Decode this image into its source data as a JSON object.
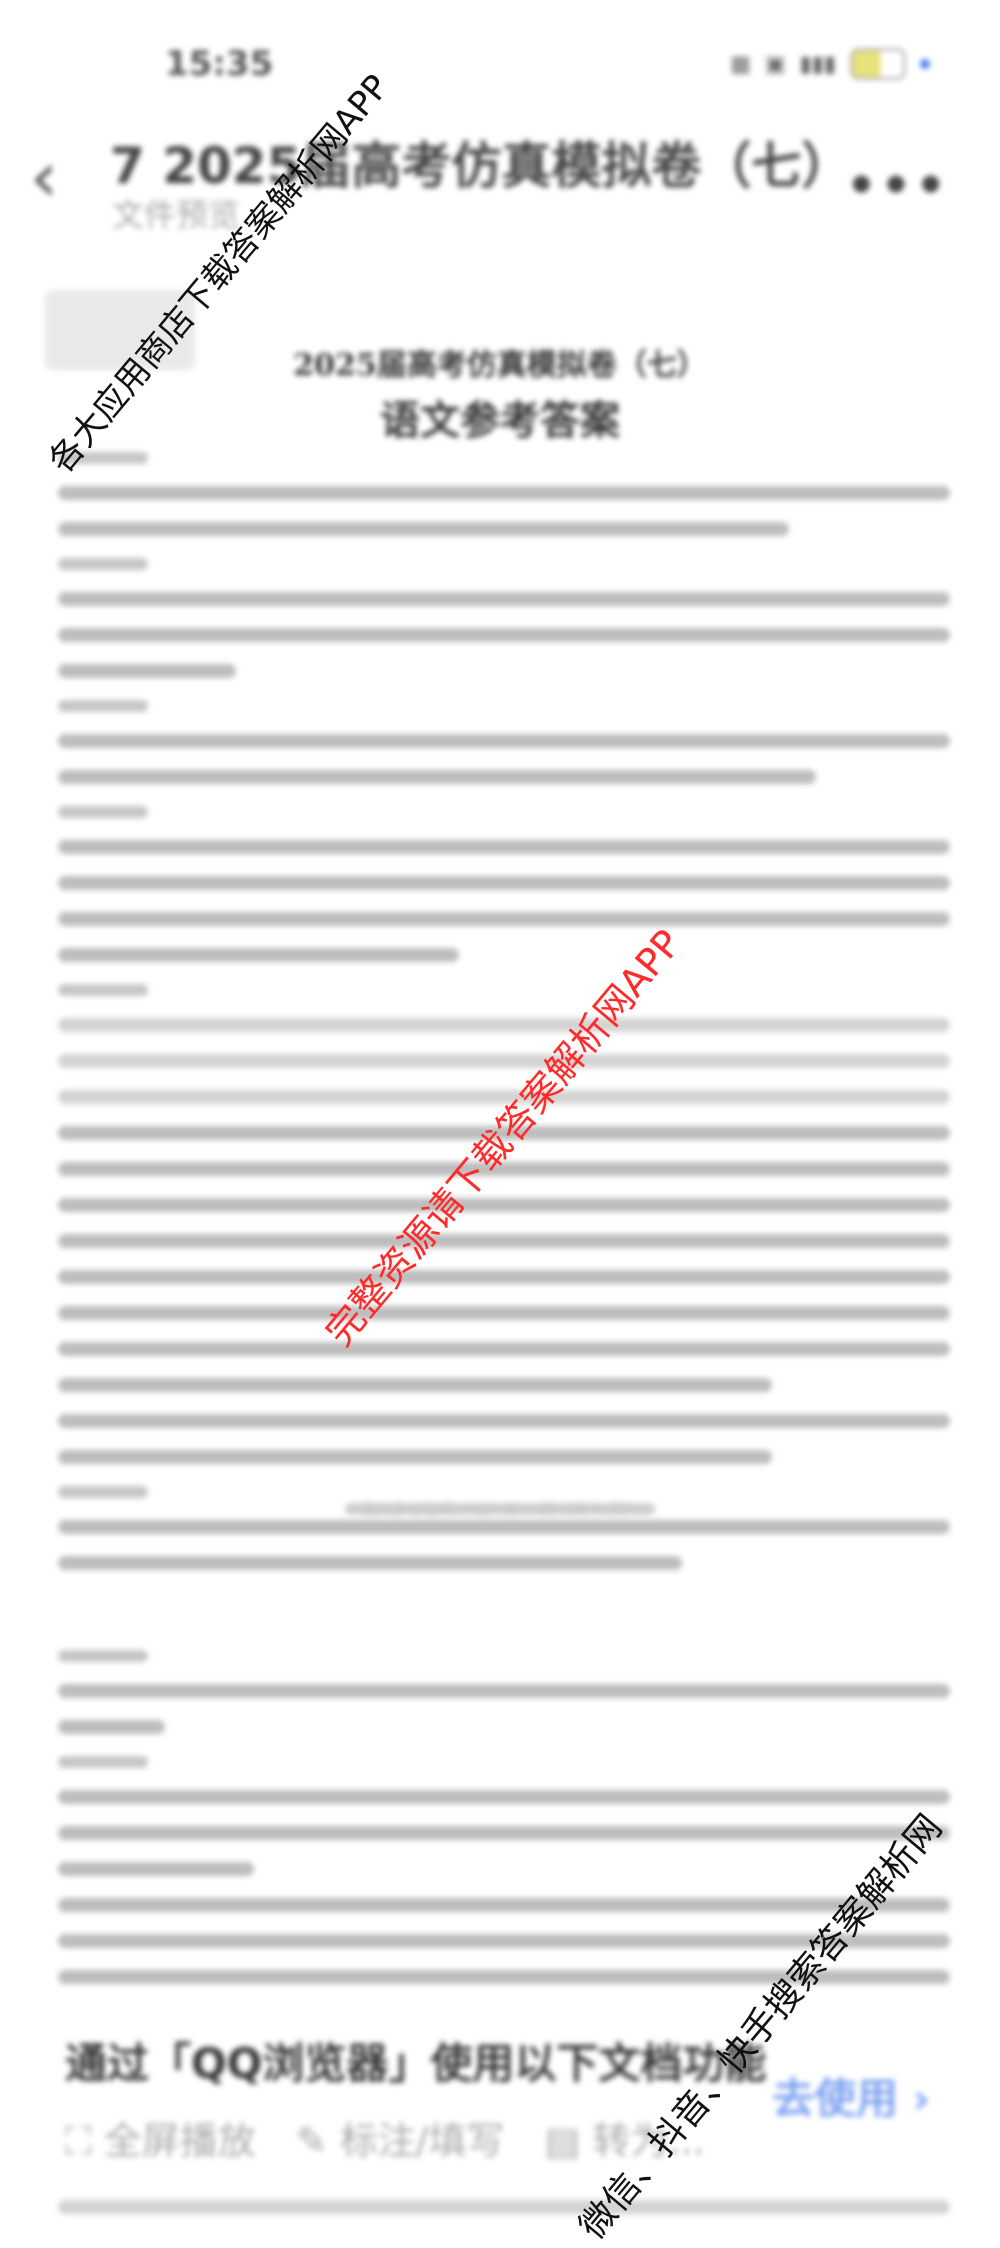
{
  "status_bar": {
    "time": "15:35"
  },
  "header": {
    "back_icon": "chevron-left-icon",
    "title": "7 2025届高考仿真模拟卷（七）...",
    "subtitle": "文件预览",
    "more_icon": "more-dots-icon"
  },
  "document": {
    "title_line1": "2025届高考仿真模拟卷（七）",
    "title_line2": "语文参考答案",
    "footer": "语文参考答案（七）第 1 页（共 6 页）"
  },
  "promo": {
    "title": "通过「QQ浏览器」使用以下文档功能",
    "fullscreen_label": "全屏播放",
    "annotate_label": "标注/填写",
    "saveas_label": "转为...",
    "use_label": "去使用 ›"
  },
  "watermarks": {
    "top_left": "各大应用商店下载答案解析网APP",
    "center": "完整资源请下载答案解析网APP",
    "bottom_right": "微信、抖音、快手搜索答案解析网"
  }
}
